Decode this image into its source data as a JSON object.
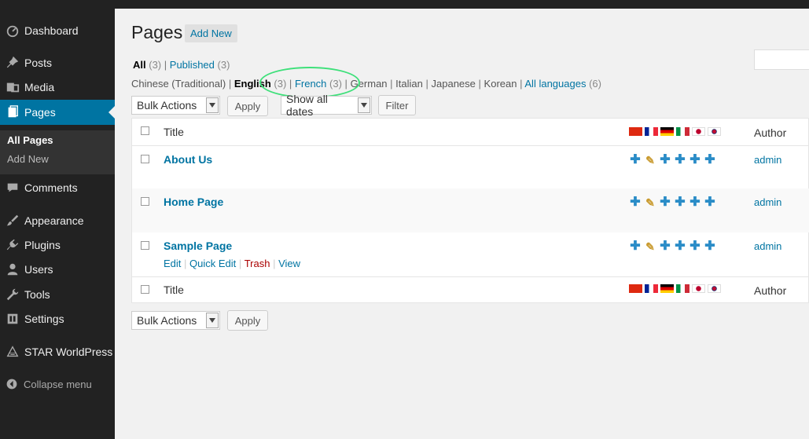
{
  "sidebar": {
    "items": [
      {
        "label": "Dashboard",
        "icon": "dashboard-icon"
      },
      {
        "label": "Posts",
        "icon": "pin-icon"
      },
      {
        "label": "Media",
        "icon": "media-icon"
      },
      {
        "label": "Pages",
        "icon": "pages-icon"
      },
      {
        "label": "Comments",
        "icon": "comment-icon"
      },
      {
        "label": "Appearance",
        "icon": "brush-icon"
      },
      {
        "label": "Plugins",
        "icon": "plugin-icon"
      },
      {
        "label": "Users",
        "icon": "user-icon"
      },
      {
        "label": "Tools",
        "icon": "wrench-icon"
      },
      {
        "label": "Settings",
        "icon": "settings-icon"
      },
      {
        "label": "STAR WorldPress",
        "icon": "triangle-icon"
      }
    ],
    "submenu": [
      "All Pages",
      "Add New"
    ],
    "collapse": "Collapse menu"
  },
  "header": {
    "title": "Pages",
    "add_new": "Add New"
  },
  "status_filters": {
    "all": "All",
    "all_count": "(3)",
    "sep": "|",
    "published": "Published",
    "published_count": "(3)"
  },
  "languages": {
    "chinese": "Chinese (Traditional)",
    "english": "English",
    "english_count": "(3)",
    "french": "French",
    "french_count": "(3)",
    "german": "German",
    "italian": "Italian",
    "japanese": "Japanese",
    "korean": "Korean",
    "all": "All languages",
    "all_count": "(6)",
    "sep": "|"
  },
  "toolbar": {
    "bulk_actions": "Bulk Actions",
    "apply": "Apply",
    "dates": "Show all dates",
    "filter": "Filter"
  },
  "table": {
    "col_title": "Title",
    "col_author": "Author",
    "rows": [
      {
        "title": "About Us",
        "author": "admin"
      },
      {
        "title": "Home Page",
        "author": "admin"
      },
      {
        "title": "Sample Page",
        "author": "admin"
      }
    ],
    "row_actions": {
      "edit": "Edit",
      "quick_edit": "Quick Edit",
      "trash": "Trash",
      "view": "View",
      "sep": "|"
    }
  },
  "colors": {
    "accent": "#0074a2",
    "sidebar": "#222222",
    "highlight": "#3ee07a",
    "trash": "#aa0000"
  }
}
